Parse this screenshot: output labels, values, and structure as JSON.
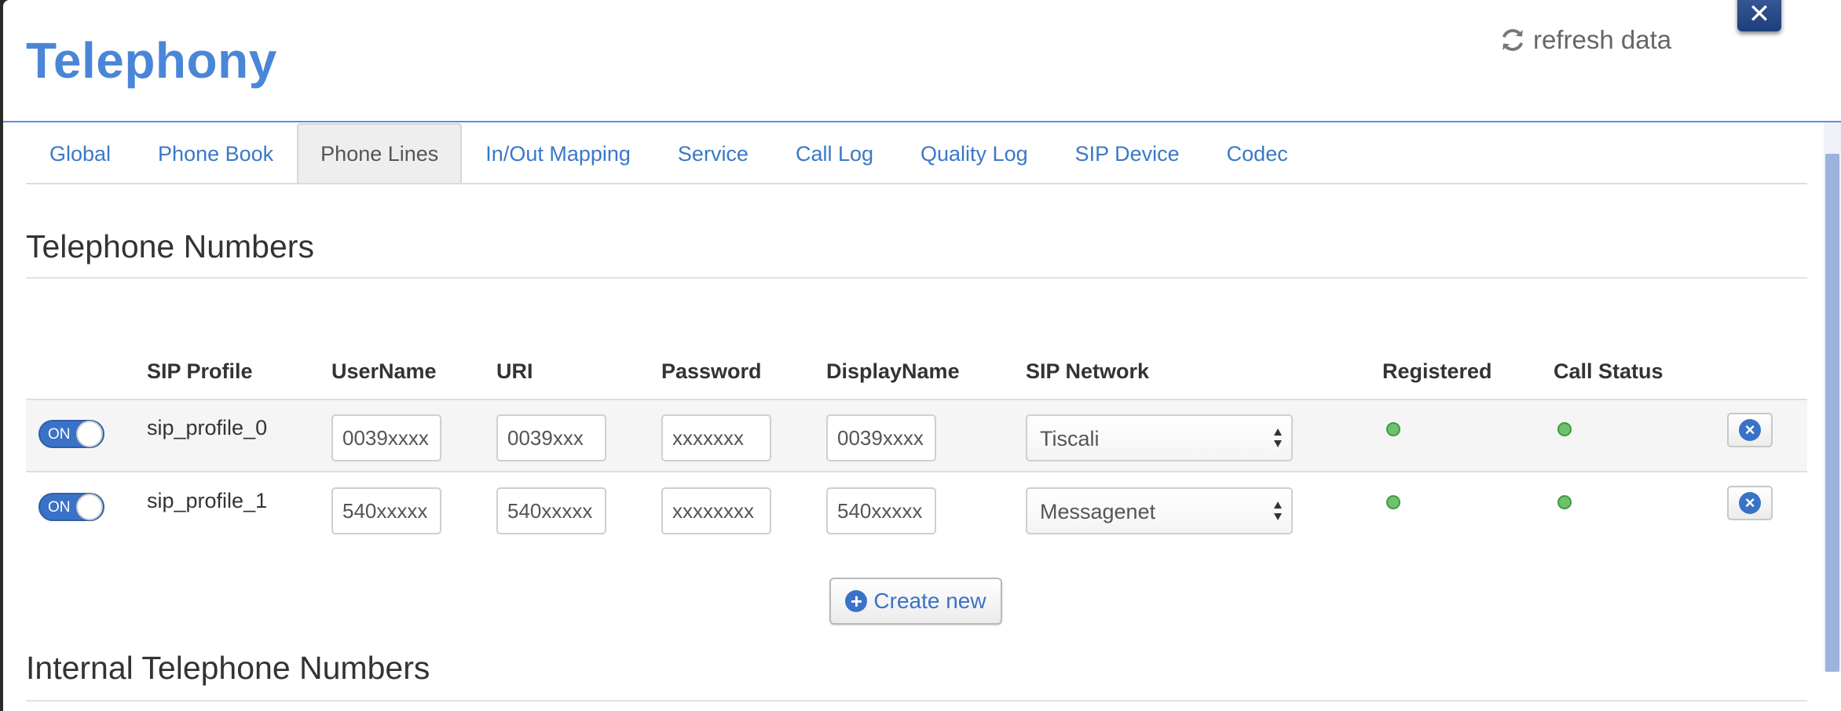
{
  "header": {
    "title": "Telephony",
    "refresh_label": "refresh data"
  },
  "close_label": "✕",
  "tabs": [
    {
      "label": "Global",
      "active": false
    },
    {
      "label": "Phone Book",
      "active": false
    },
    {
      "label": "Phone Lines",
      "active": true
    },
    {
      "label": "In/Out Mapping",
      "active": false
    },
    {
      "label": "Service",
      "active": false
    },
    {
      "label": "Call Log",
      "active": false
    },
    {
      "label": "Quality Log",
      "active": false
    },
    {
      "label": "SIP Device",
      "active": false
    },
    {
      "label": "Codec",
      "active": false
    }
  ],
  "telephone_numbers": {
    "title": "Telephone Numbers",
    "columns": {
      "sip_profile": "SIP Profile",
      "username": "UserName",
      "uri": "URI",
      "password": "Password",
      "displayname": "DisplayName",
      "sip_network": "SIP Network",
      "registered": "Registered",
      "call_status": "Call Status"
    },
    "rows": [
      {
        "enabled_label": "ON",
        "sip_profile": "sip_profile_0",
        "username": "0039xxxx",
        "uri": "0039xxx",
        "password": "xxxxxxx",
        "displayname": "0039xxxx",
        "sip_network": "Tiscali",
        "registered_status": "green",
        "call_status": "green"
      },
      {
        "enabled_label": "ON",
        "sip_profile": "sip_profile_1",
        "username": "540xxxxx",
        "uri": "540xxxxx",
        "password": "xxxxxxxx",
        "displayname": "540xxxxx",
        "sip_network": "Messagenet",
        "registered_status": "green",
        "call_status": "green"
      }
    ],
    "create_label": "Create new"
  },
  "internal_numbers": {
    "title": "Internal Telephone Numbers"
  },
  "colors": {
    "accent": "#4a86d8",
    "status_ok": "#6cc36c"
  }
}
